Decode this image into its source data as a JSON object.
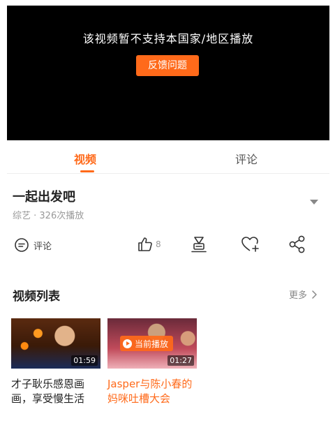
{
  "player": {
    "message": "该视频暂不支持本国家/地区播放",
    "feedback_label": "反馈问题"
  },
  "tabs": [
    {
      "label": "视频",
      "active": true
    },
    {
      "label": "评论",
      "active": false
    }
  ],
  "video": {
    "title": "一起出发吧",
    "meta": "综艺 · 326次播放"
  },
  "actions": {
    "comment_label": "评论",
    "like_count": "8",
    "icons": [
      "comment-icon",
      "like-icon",
      "coin-icon",
      "favorite-icon",
      "share-icon"
    ]
  },
  "playlist": {
    "title": "视频列表",
    "more_label": "更多",
    "items": [
      {
        "title": "才子耿乐感恩画画，享受慢生活",
        "duration": "01:59",
        "current": false
      },
      {
        "title": "Jasper与陈小春的妈咪吐槽大会",
        "duration": "01:27",
        "current": true,
        "badge": "当前播放"
      }
    ]
  },
  "colors": {
    "accent": "#ff6a1a",
    "player_bg": "#000000",
    "muted_text": "#999999"
  }
}
